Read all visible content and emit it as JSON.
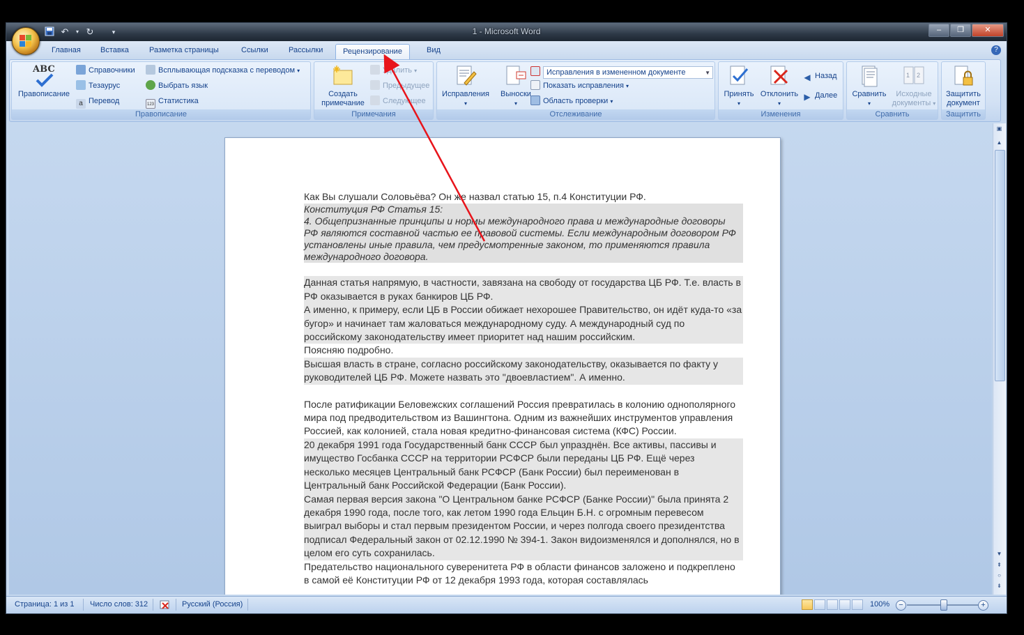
{
  "window": {
    "title": "1 - Microsoft Word"
  },
  "tabs": [
    {
      "label": "Главная"
    },
    {
      "label": "Вставка"
    },
    {
      "label": "Разметка страницы"
    },
    {
      "label": "Ссылки"
    },
    {
      "label": "Рассылки"
    },
    {
      "label": "Рецензирование",
      "active": true
    },
    {
      "label": "Вид"
    }
  ],
  "ribbon": {
    "proofing": {
      "label": "Правописание",
      "spelling": "Правописание",
      "spelling_icon_text": "ABC",
      "research": "Справочники",
      "thesaurus": "Тезаурус",
      "translate": "Перевод",
      "translation_tip": "Всплывающая подсказка с переводом",
      "set_language": "Выбрать язык",
      "statistics": "Статистика"
    },
    "comments": {
      "label": "Примечания",
      "new_comment_line1": "Создать",
      "new_comment_line2": "примечание",
      "delete": "Удалить",
      "previous": "Предыдущее",
      "next": "Следующее"
    },
    "tracking": {
      "label": "Отслеживание",
      "track_changes": "Исправления",
      "balloons": "Выноски",
      "display_dropdown": "Исправления в измененном документе",
      "show_markup": "Показать исправления",
      "reviewing_pane": "Область проверки"
    },
    "changes": {
      "label": "Изменения",
      "accept": "Принять",
      "reject": "Отклонить",
      "previous": "Назад",
      "next": "Далее"
    },
    "compare": {
      "label": "Сравнить",
      "compare": "Сравнить",
      "source_line1": "Исходные",
      "source_line2": "документы"
    },
    "protect": {
      "label": "Защитить",
      "protect_line1": "Защитить",
      "protect_line2": "документ"
    }
  },
  "document": {
    "p1": "Как Вы слушали Соловьёва? Он же назвал статью 15, п.4 Конституции РФ.",
    "quote_title": "Конституция РФ Статья 15:",
    "quote_body": "4. Общепризнанные принципы и нормы международного права и международные договоры РФ являются составной частью ее правовой системы. Если международным договором РФ установлены иные правила, чем предусмотренные законом, то применяются правила международного договора.",
    "p2": "Данная статья напрямую, в частности, завязана на свободу от государства ЦБ РФ. Т.е. власть в РФ оказывается в руках банкиров ЦБ РФ.",
    "p3": "А именно, к примеру, если ЦБ в России обижает нехорошее Правительство, он идёт куда-то «за бугор» и начинает там жаловаться международному суду. А международный суд по российскому законодательству имеет приоритет над нашим российским.",
    "p4": "Поясняю подробно.",
    "p5": "Высшая власть в стране, согласно российскому законодательству, оказывается по факту у руководителей ЦБ РФ. Можете назвать это \"двоевластием\". А именно.",
    "p6": "После ратификации Беловежских соглашений Россия превратилась в колонию однополярного мира под предводительством из Вашингтона. Одним из важнейших инструментов управления Россией, как колонией, стала новая кредитно-финансовая система (КФС) России.",
    "p7": "20 декабря 1991 года Государственный банк СССР был упразднён. Все активы, пассивы и имущество Госбанка СССР на территории РСФСР были переданы ЦБ РФ. Ещё через несколько месяцев Центральный банк РСФСР (Банк России) был переименован в Центральный банк Российской Федерации (Банк России).",
    "p8": "Самая первая версия закона \"О Центральном банке РСФСР (Банке России)\" была принята 2 декабря 1990 года, после того, как летом 1990 года Ельцин Б.Н. с огромным перевесом выиграл выборы и стал первым президентом России, и через полгода своего президентства подписал Федеральный закон от 02.12.1990 № 394-1. Закон видоизменялся и дополнялся, но в целом его суть сохранилась.",
    "p9": "Предательство национального суверенитета РФ в области финансов заложено и подкреплено в самой её Конституции РФ от 12 декабря 1993 года, которая составлялась"
  },
  "statusbar": {
    "page": "Страница: 1 из 1",
    "words": "Число слов: 312",
    "language": "Русский (Россия)",
    "zoom": "100%",
    "zoom_level": 1.0
  },
  "colors": {
    "annotation_arrow": "#e8141b",
    "ribbon_text": "#15428b"
  }
}
